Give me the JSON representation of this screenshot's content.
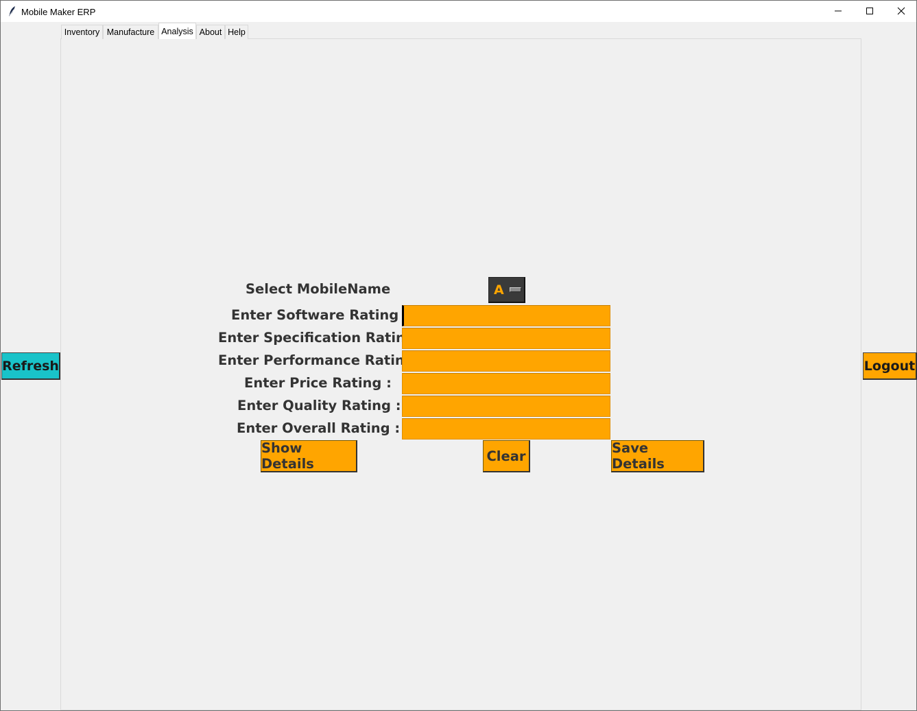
{
  "window": {
    "title": "Mobile Maker ERP",
    "icons": {
      "app": "feather-icon",
      "minimize": "minimize-icon",
      "maximize": "maximize-icon",
      "close": "close-icon"
    }
  },
  "tabs": [
    {
      "label": "Inventory",
      "active": false
    },
    {
      "label": "Manufacture",
      "active": false
    },
    {
      "label": "Analysis",
      "active": true
    },
    {
      "label": "About",
      "active": false
    },
    {
      "label": "Help",
      "active": false
    }
  ],
  "side": {
    "refresh_label": "Refresh",
    "logout_label": "Logout"
  },
  "form": {
    "select_label": "Select MobileName",
    "select_value": "A",
    "fields": {
      "software": {
        "label": "Enter Software Rating :",
        "value": ""
      },
      "specification": {
        "label": "Enter Specification Rating :",
        "value": ""
      },
      "performance": {
        "label": "Enter Performance Rating :",
        "value": ""
      },
      "price": {
        "label": "Enter Price Rating :",
        "value": ""
      },
      "quality": {
        "label": "Enter Quality Rating :",
        "value": ""
      },
      "overall": {
        "label": "Enter Overall Rating :",
        "value": ""
      }
    },
    "buttons": {
      "show": "Show Details",
      "clear": "Clear",
      "save": "Save Details"
    }
  },
  "colors": {
    "accent": "#ffa500",
    "refresh": "#19c3c9",
    "background": "#f0f0f0",
    "option_menu": "#3a3a3a"
  }
}
